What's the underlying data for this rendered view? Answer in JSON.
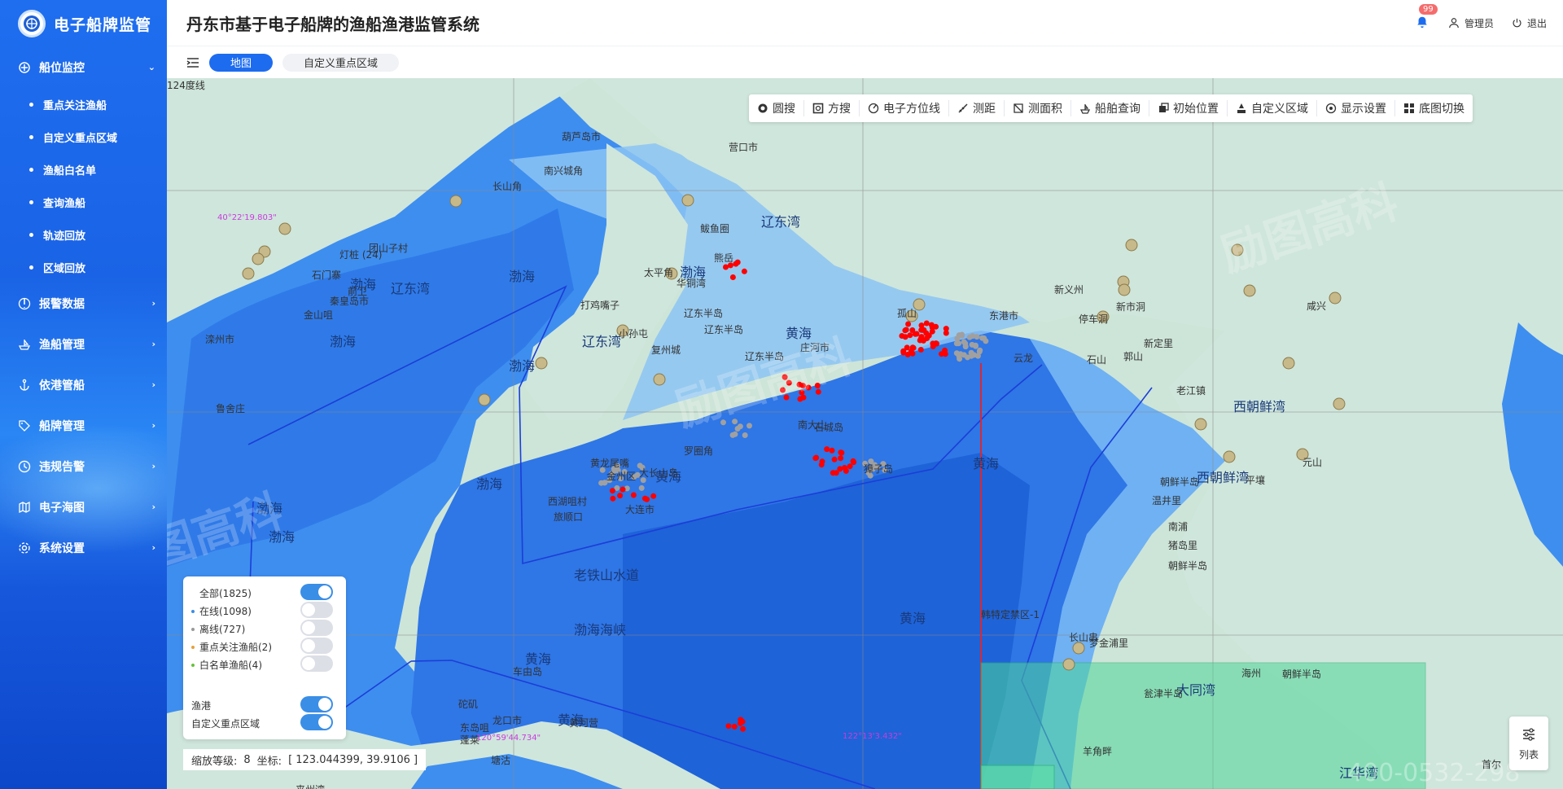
{
  "sidebar": {
    "title": "电子船牌监管",
    "menu": [
      {
        "label": "船位监控",
        "icon": "crosshair-icon",
        "expanded": true,
        "children": [
          "重点关注渔船",
          "自定义重点区域",
          "渔船白名单",
          "查询渔船",
          "轨迹回放",
          "区域回放"
        ]
      },
      {
        "label": "报警数据",
        "icon": "alert-icon"
      },
      {
        "label": "渔船管理",
        "icon": "ship-icon"
      },
      {
        "label": "依港管船",
        "icon": "anchor-icon"
      },
      {
        "label": "船牌管理",
        "icon": "tag-icon"
      },
      {
        "label": "违规告警",
        "icon": "clock-icon"
      },
      {
        "label": "电子海图",
        "icon": "map-icon"
      },
      {
        "label": "系统设置",
        "icon": "gear-icon"
      }
    ]
  },
  "header": {
    "title": "丹东市基于电子船牌的渔船渔港监管系统",
    "notification_count": "99",
    "user": "管理员",
    "logout": "退出"
  },
  "tabs": {
    "map": "地图",
    "custom_area": "自定义重点区域"
  },
  "toolbar": [
    {
      "label": "圆搜",
      "icon": "circle-search-icon"
    },
    {
      "label": "方搜",
      "icon": "square-search-icon"
    },
    {
      "label": "电子方位线",
      "icon": "bearing-line-icon"
    },
    {
      "label": "测距",
      "icon": "ruler-icon"
    },
    {
      "label": "测面积",
      "icon": "area-icon"
    },
    {
      "label": "船舶查询",
      "icon": "ship-query-icon"
    },
    {
      "label": "初始位置",
      "icon": "home-position-icon"
    },
    {
      "label": "自定义区域",
      "icon": "custom-area-icon"
    },
    {
      "label": "显示设置",
      "icon": "display-settings-icon"
    },
    {
      "label": "底图切换",
      "icon": "basemap-switch-icon"
    }
  ],
  "legend": {
    "items": [
      {
        "label": "全部(1825)",
        "on": true,
        "color": ""
      },
      {
        "label": "在线(1098)",
        "on": false,
        "color": "#3a8ee6"
      },
      {
        "label": "离线(727)",
        "on": false,
        "color": "#999999"
      },
      {
        "label": "重点关注渔船(2)",
        "on": false,
        "color": "#e6a23c"
      },
      {
        "label": "白名单渔船(4)",
        "on": false,
        "color": "#67c23a"
      }
    ],
    "layers": [
      {
        "label": "渔港",
        "on": true
      },
      {
        "label": "自定义重点区域",
        "on": true
      }
    ]
  },
  "status": {
    "zoom_label": "缩放等级:",
    "zoom": "8",
    "coord_label": "坐标:",
    "coord": "[ 123.044399, 39.9106 ]"
  },
  "list_button": "列表",
  "map": {
    "labels_sea": [
      "渤海",
      "渤海",
      "渤海",
      "渤海",
      "渤海",
      "渤海",
      "渤海",
      "渤海",
      "黄海",
      "黄海",
      "黄海",
      "黄海",
      "黄海",
      "黄海",
      "辽东湾",
      "辽东湾",
      "辽东湾",
      "西朝鲜湾",
      "西朝鲜湾",
      "大同湾",
      "江华湾",
      "老铁山水道",
      "渤海海峡"
    ],
    "labels_place": [
      "葫芦岛市",
      "营口市",
      "南兴城角",
      "长山角",
      "鲅鱼圈",
      "熊岳",
      "太平角",
      "华铜湾",
      "打鸡嘴子",
      "辽东半岛",
      "辽东半岛",
      "辽东半岛",
      "小孙屯",
      "复州城",
      "庄河市",
      "孤山",
      "东港市",
      "新义州",
      "新市洞",
      "停车洞",
      "云龙",
      "石山",
      "郭山",
      "新定里",
      "老江镇",
      "咸兴",
      "元山",
      "平壤",
      "朝鲜半岛",
      "朝鲜半岛",
      "朝鲜半岛",
      "温井里",
      "南浦",
      "猪岛里",
      "海州",
      "瓮津半岛",
      "首尔",
      "长山串",
      "梦金浦里",
      "滦州市",
      "鲁舍庄",
      "灯桩 (24)",
      "石门寨",
      "秦皇岛市",
      "金山咀",
      "团山子村",
      "前卫",
      "西湖咀村",
      "旅顺口",
      "大连市",
      "金州区",
      "大长山岛",
      "黄龙尾嘴",
      "獐子岛",
      "石城岛",
      "南大山",
      "罗圈角",
      "塘沽",
      "龙口市",
      "蓬莱",
      "黄河营",
      "东岛咀",
      "车由岛",
      "砣矶",
      "黄山馆",
      "来州湾",
      "羊角畔",
      "韩特定禁区-1",
      "124度线"
    ],
    "grid_labels": [
      "40°22'19.803\"",
      "120°59'44.734\"",
      "122°13'3.432\""
    ],
    "watermark": "励图高科",
    "phone_watermark": "400-0532-298"
  }
}
